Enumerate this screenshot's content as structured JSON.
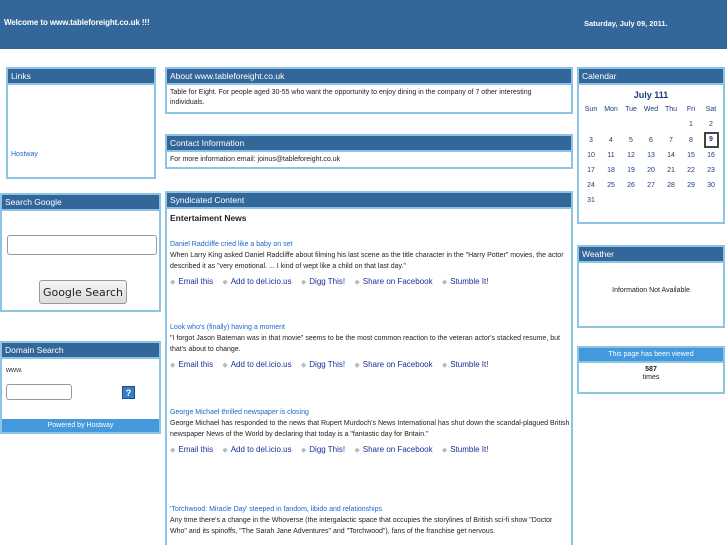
{
  "header": {
    "welcome": "Welcome to www.tableforeight.co.uk !!!",
    "date": "Saturday, July 09, 2011."
  },
  "links": {
    "title": "Links",
    "items": [
      "Hostway"
    ]
  },
  "google_search": {
    "title": "Search Google",
    "input_value": "",
    "button_label": "Google Search"
  },
  "domain_search": {
    "title": "Domain Search",
    "prefix": "www.",
    "input_value": "",
    "help_label": "?",
    "powered_by": "Powered by Hostway"
  },
  "about": {
    "title": "About www.tableforeight.co.uk",
    "text": "Table for Eight. For people aged 30-55 who want the opportunity to enjoy dining in the company of 7 other interesting individuals."
  },
  "contact": {
    "title": "Contact Information",
    "text": "For more information email: joinus@tableforeight.co.uk"
  },
  "syndicated": {
    "title": "Syndicated Content",
    "subtitle": "Entertaiment News",
    "actions": [
      "Email this",
      "Add to del.icio.us",
      "Digg This!",
      "Share on Facebook",
      "Stumble It!"
    ],
    "items": [
      {
        "title": "Daniel Radcliffe cried like a baby on set",
        "desc": "When Larry King asked Daniel Radcliffe about filming his last scene as the title character in the \"Harry Potter\" movies, the actor described it as \"very emotional. ... I kind of wept like a child on that last day.\""
      },
      {
        "title": "Look who's (finally) having a moment",
        "desc": "\"I forgot Jason Bateman was in that movie\" seems to be the most common reaction to the veteran actor's stacked resume, but that's about to change."
      },
      {
        "title": "George Michael thrilled newspaper is closing",
        "desc": "George Michael has responded to the news that Rupert Murdoch's News International has shut down the scandal-plagued British newspaper News of the World by declaring that today is a \"fantastic day for Britain.\""
      },
      {
        "title": "'Torchwood: Miracle Day' steeped in fandom, libido and relationships",
        "desc": "Any time there's a change in the Whoverse (the intergalactic space that occupies the storylines of British sci-fi show \"Doctor Who\" and its spinoffs, \"The Sarah Jane Adventures\" and \"Torchwood\"), fans of the franchise get nervous."
      }
    ]
  },
  "calendar": {
    "title": "Calendar",
    "month": "July 111",
    "weekdays": [
      "Sun",
      "Mon",
      "Tue",
      "Wed",
      "Thu",
      "Fri",
      "Sat"
    ],
    "weeks": [
      [
        "",
        "",
        "",
        "",
        "",
        "1",
        "2"
      ],
      [
        "3",
        "4",
        "5",
        "6",
        "7",
        "8",
        "9"
      ],
      [
        "10",
        "11",
        "12",
        "13",
        "14",
        "15",
        "16"
      ],
      [
        "17",
        "18",
        "19",
        "20",
        "21",
        "22",
        "23"
      ],
      [
        "24",
        "25",
        "26",
        "27",
        "28",
        "29",
        "30"
      ],
      [
        "31",
        "",
        "",
        "",
        "",
        "",
        ""
      ]
    ],
    "today": "9"
  },
  "weather": {
    "title": "Weather",
    "text": "Information Not Available"
  },
  "views": {
    "title": "This page has been viewed",
    "count": "587",
    "suffix": "times"
  },
  "colors": {
    "header_bg": "#336699",
    "border": "#8cc4e6",
    "accent": "#4499dd",
    "link": "#1a66cc"
  }
}
